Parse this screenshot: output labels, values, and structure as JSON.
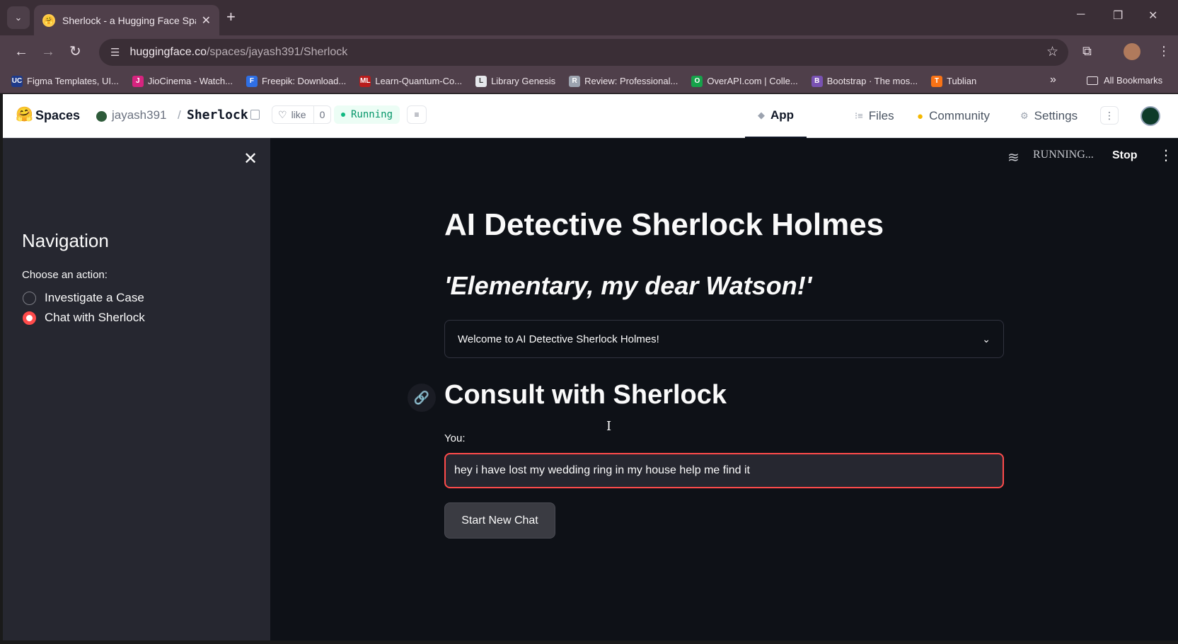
{
  "browser": {
    "tab_title": "Sherlock - a Hugging Face Spac",
    "url_host": "huggingface.co",
    "url_path": "/spaces/jayash391/Sherlock",
    "bookmarks": [
      {
        "label": "Figma Templates, UI...",
        "icon": "UC",
        "color": "#1e3a8a"
      },
      {
        "label": "JioCinema - Watch...",
        "icon": "J",
        "color": "#d6247f"
      },
      {
        "label": "Freepik: Download...",
        "icon": "F",
        "color": "#2f6fe4"
      },
      {
        "label": "Learn-Quantum-Co...",
        "icon": "ML",
        "color": "#b91c1c"
      },
      {
        "label": "Library Genesis",
        "icon": "L",
        "color": "#e5e7eb"
      },
      {
        "label": "Review: Professional...",
        "icon": "R",
        "color": "#9ca3af"
      },
      {
        "label": "OverAPI.com | Colle...",
        "icon": "O",
        "color": "#16a34a"
      },
      {
        "label": "Bootstrap · The mos...",
        "icon": "B",
        "color": "#7952b3"
      },
      {
        "label": "Tublian",
        "icon": "T",
        "color": "#f97316"
      }
    ],
    "all_bookmarks": "All Bookmarks"
  },
  "hf": {
    "spaces": "Spaces",
    "owner": "jayash391",
    "separator": "/",
    "repo": "Sherlock",
    "like_label": "like",
    "like_count": "0",
    "status": "Running",
    "nav": {
      "app": "App",
      "files": "Files",
      "community": "Community",
      "settings": "Settings"
    }
  },
  "sidebar": {
    "title": "Navigation",
    "label": "Choose an action:",
    "options": [
      "Investigate a Case",
      "Chat with Sherlock"
    ],
    "selected_index": 1
  },
  "main": {
    "status_text": "RUNNING...",
    "stop": "Stop",
    "title": "AI Detective Sherlock Holmes",
    "subtitle": "'Elementary, my dear Watson!'",
    "expander_title": "Welcome to AI Detective Sherlock Holmes!",
    "section_title": "Consult with Sherlock",
    "input_label": "You:",
    "input_value": "hey i have lost my wedding ring in my house help me find it",
    "button": "Start New Chat"
  }
}
